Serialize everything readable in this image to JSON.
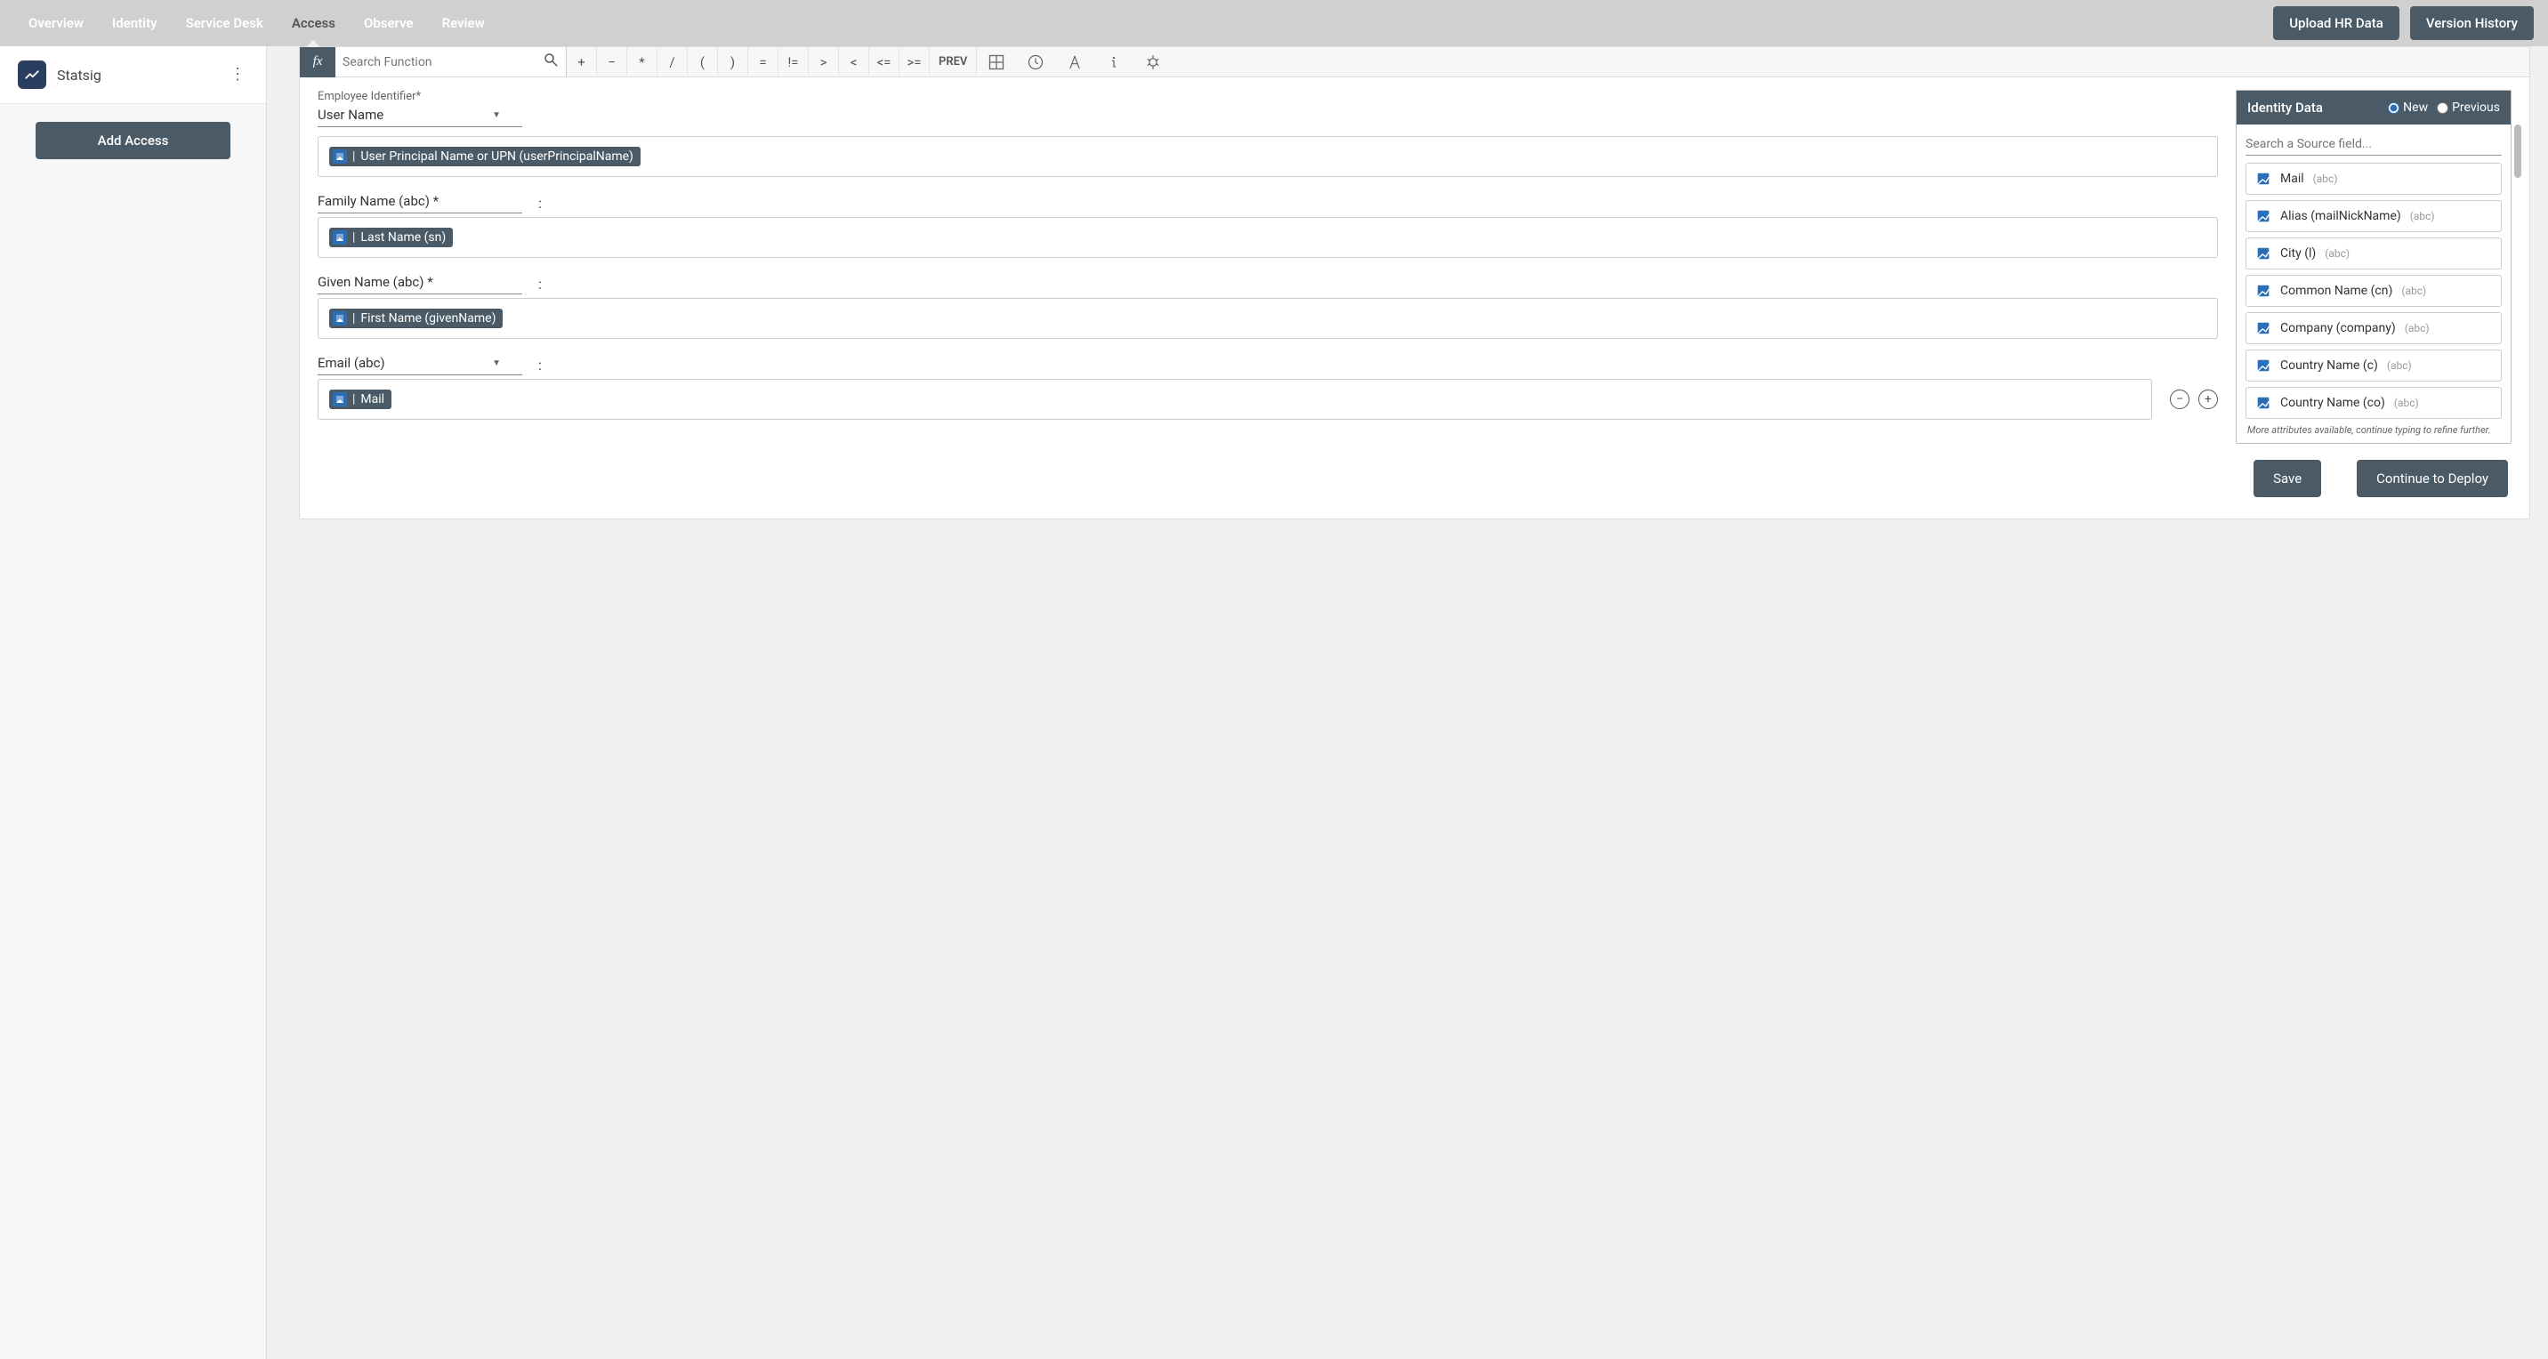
{
  "nav": {
    "tabs": [
      "Overview",
      "Identity",
      "Service Desk",
      "Access",
      "Observe",
      "Review"
    ],
    "active_index": 3,
    "upload_btn": "Upload HR Data",
    "version_btn": "Version History"
  },
  "sidebar": {
    "app_name": "Statsig",
    "add_btn": "Add Access"
  },
  "formula_bar": {
    "fx": "fx",
    "search_placeholder": "Search Function",
    "ops": [
      "+",
      "−",
      "*",
      "/",
      "(",
      ")",
      "=",
      "!=",
      ">",
      "<",
      "<=",
      ">="
    ],
    "prev": "PREV"
  },
  "form": {
    "employee_id_label": "Employee Identifier*",
    "employee_id_value": "User Name",
    "employee_id_token": "User Principal Name or UPN (userPrincipalName)",
    "family_label": "Family Name (abc) *",
    "family_token": "Last Name (sn)",
    "given_label": "Given Name (abc) *",
    "given_token": "First Name (givenName)",
    "email_label": "Email (abc)",
    "email_token": "Mail"
  },
  "panel": {
    "title": "Identity Data",
    "radio_new": "New",
    "radio_prev": "Previous",
    "search_placeholder": "Search a Source field...",
    "items": [
      {
        "name": "Mail",
        "type": "(abc)"
      },
      {
        "name": "Alias (mailNickName)",
        "type": "(abc)"
      },
      {
        "name": "City (l)",
        "type": "(abc)"
      },
      {
        "name": "Common Name (cn)",
        "type": "(abc)"
      },
      {
        "name": "Company (company)",
        "type": "(abc)"
      },
      {
        "name": "Country Name (c)",
        "type": "(abc)"
      },
      {
        "name": "Country Name (co)",
        "type": "(abc)"
      }
    ],
    "hint": "More attributes available, continue typing to refine further."
  },
  "footer": {
    "save": "Save",
    "deploy": "Continue to Deploy"
  }
}
